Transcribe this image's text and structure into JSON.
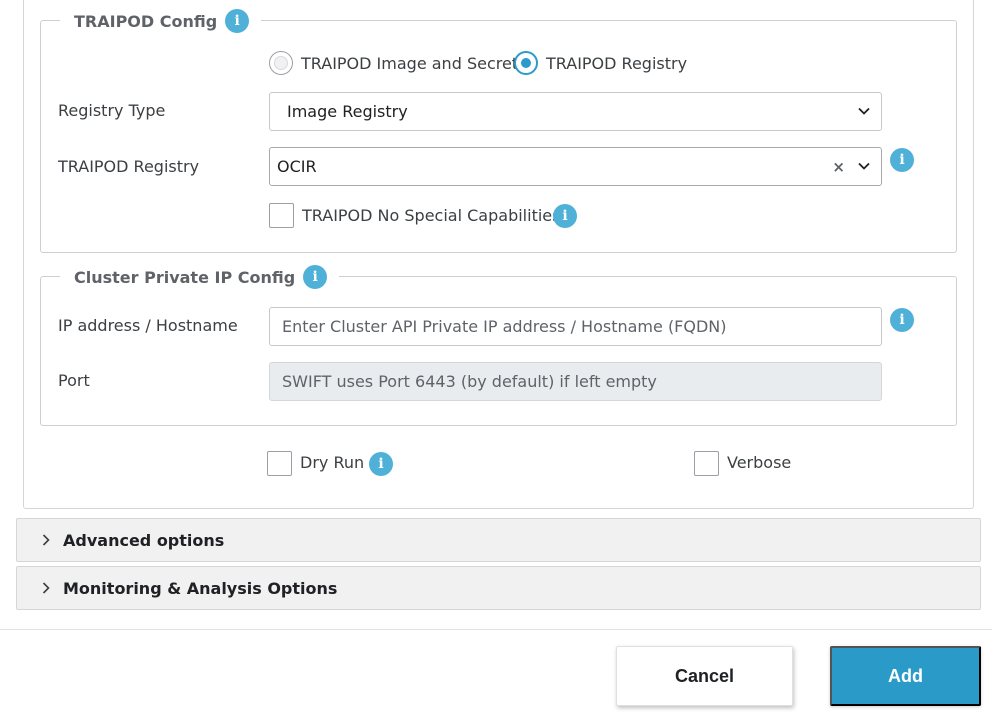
{
  "traipod_config": {
    "legend": "TRAIPOD Config",
    "radio_options": [
      {
        "label": "TRAIPOD Image and Secret",
        "checked": false
      },
      {
        "label": "TRAIPOD Registry",
        "checked": true
      }
    ],
    "registry_type": {
      "label": "Registry Type",
      "value": "Image Registry"
    },
    "traipod_registry": {
      "label": "TRAIPOD Registry",
      "value": "OCIR",
      "clear_glyph": "×"
    },
    "no_special_caps": {
      "label": "TRAIPOD No Special Capabilities",
      "checked": false
    }
  },
  "cluster_config": {
    "legend": "Cluster Private IP Config",
    "ip": {
      "label": "IP address / Hostname",
      "placeholder": "Enter Cluster API Private IP address / Hostname (FQDN)"
    },
    "port": {
      "label": "Port",
      "placeholder": "SWIFT uses Port 6443 (by default) if left empty"
    }
  },
  "options": {
    "dry_run": {
      "label": "Dry Run",
      "checked": false
    },
    "verbose": {
      "label": "Verbose",
      "checked": false
    }
  },
  "accordions": {
    "advanced": "Advanced options",
    "monitoring": "Monitoring & Analysis Options"
  },
  "footer": {
    "cancel": "Cancel",
    "add": "Add"
  },
  "icons": {
    "info_glyph": "i"
  },
  "colors": {
    "accent": "#2a9bc9",
    "info": "#4fb0d8"
  }
}
